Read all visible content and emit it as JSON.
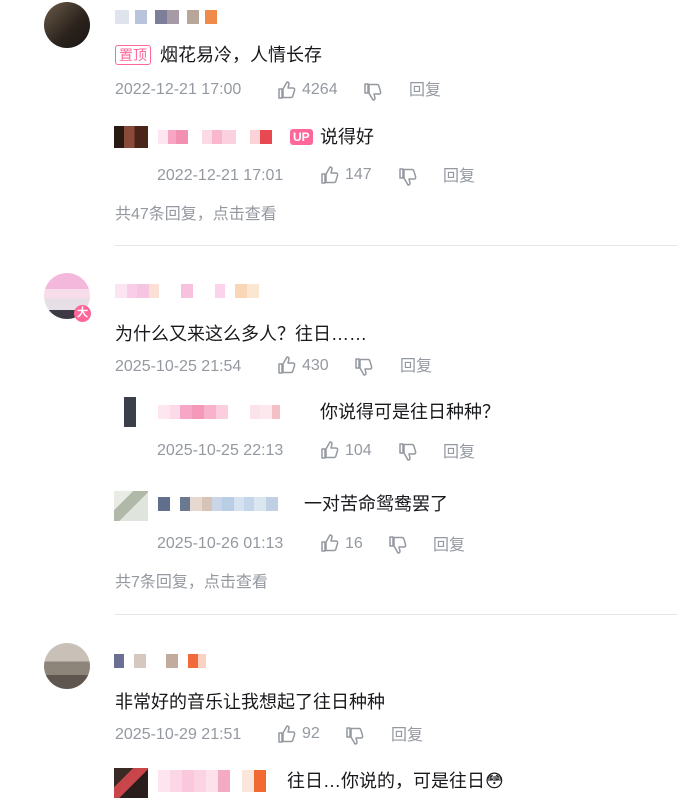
{
  "comments": [
    {
      "pin_label": "置顶",
      "text": "烟花易冷，人情长存",
      "time": "2022-12-21 17:00",
      "likes": "4264",
      "reply_label": "回复",
      "replies": [
        {
          "up_label": "UP",
          "text": "说得好",
          "time": "2022-12-21 17:01",
          "likes": "147",
          "reply_label": "回复"
        }
      ],
      "more_replies": "共47条回复，点击查看"
    },
    {
      "text": "为什么又来这么多人？往日……",
      "time": "2025-10-25 21:54",
      "likes": "430",
      "reply_label": "回复",
      "replies": [
        {
          "text": "你说得可是往日种种？",
          "time": "2025-10-25 22:13",
          "likes": "104",
          "reply_label": "回复"
        },
        {
          "text": "一对苦命鸳鸯罢了",
          "time": "2025-10-26 01:13",
          "likes": "16",
          "reply_label": "回复"
        }
      ],
      "more_replies": "共7条回复，点击查看"
    },
    {
      "text": "非常好的音乐让我想起了往日种种",
      "time": "2025-10-29 21:51",
      "likes": "92",
      "reply_label": "回复",
      "replies": [
        {
          "text": "往日…你说的，可是往日😳"
        }
      ]
    }
  ],
  "colors": {
    "accent": "#ff6699",
    "meta": "#9499a0",
    "divider": "#e3e5e7"
  },
  "icons": {
    "like": "thumbs-up-icon",
    "dislike": "thumbs-down-icon"
  }
}
